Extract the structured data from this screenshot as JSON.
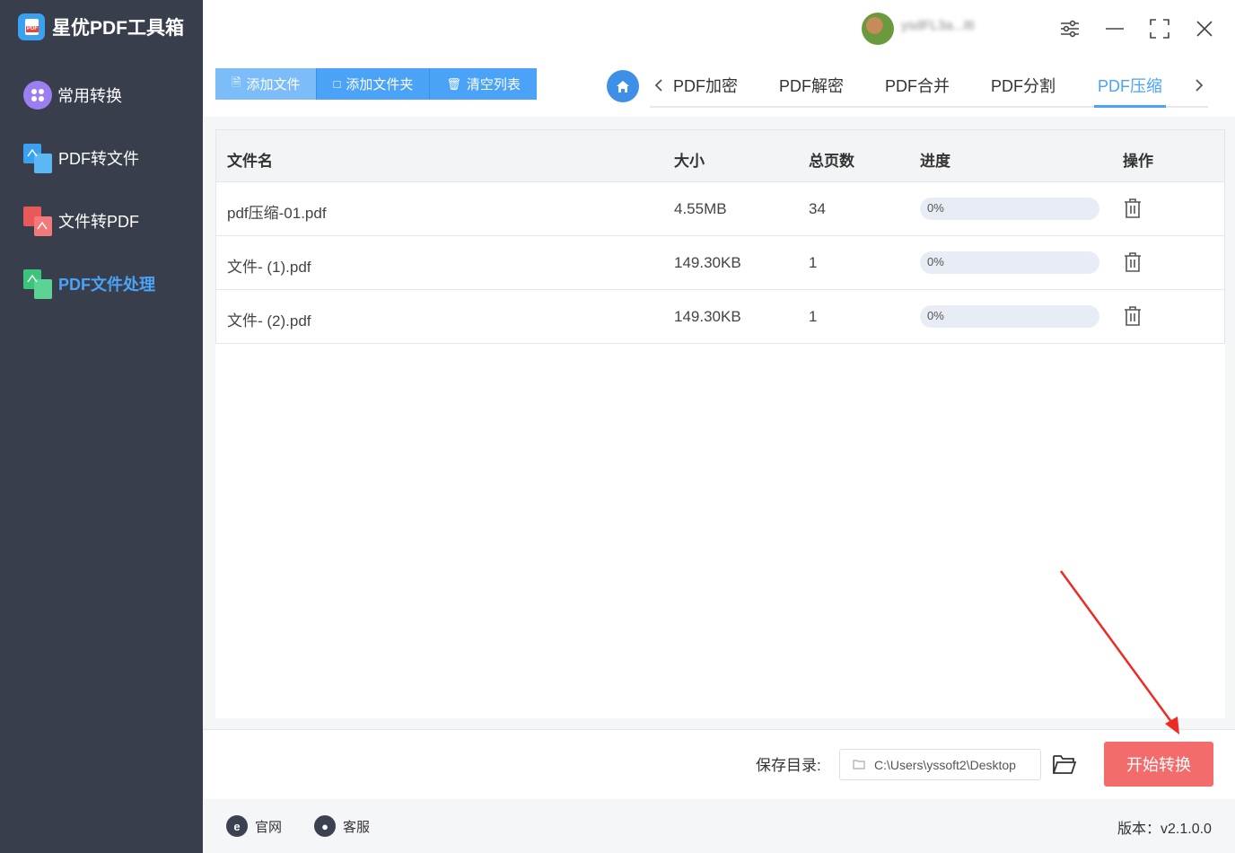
{
  "app": {
    "title": "星优PDF工具箱"
  },
  "sidebar": {
    "items": [
      {
        "label": "常用转换",
        "icon": "apps-icon",
        "active": false
      },
      {
        "label": "PDF转文件",
        "icon": "pdf-to-file-icon",
        "active": false
      },
      {
        "label": "文件转PDF",
        "icon": "file-to-pdf-icon",
        "active": false
      },
      {
        "label": "PDF文件处理",
        "icon": "pdf-process-icon",
        "active": true
      }
    ]
  },
  "header": {
    "username": "ysdFL3a...l6",
    "controls": [
      "settings-icon",
      "minimize-icon",
      "maximize-icon",
      "close-icon"
    ]
  },
  "toolbar": {
    "add_file": "添加文件",
    "add_folder": "添加文件夹",
    "clear_list": "清空列表"
  },
  "tabs": {
    "items": [
      "PDF加密",
      "PDF解密",
      "PDF合并",
      "PDF分割",
      "PDF压缩"
    ],
    "active": "PDF压缩"
  },
  "table": {
    "columns": [
      "文件名",
      "大小",
      "总页数",
      "进度",
      "操作"
    ],
    "rows": [
      {
        "name": "pdf压缩-01.pdf",
        "size": "4.55MB",
        "pages": "34",
        "progress": "0%"
      },
      {
        "name": "文件- (1).pdf",
        "size": "149.30KB",
        "pages": "1",
        "progress": "0%"
      },
      {
        "name": "文件- (2).pdf",
        "size": "149.30KB",
        "pages": "1",
        "progress": "0%"
      }
    ]
  },
  "save": {
    "label": "保存目录:",
    "path": "C:\\Users\\yssoft2\\Desktop"
  },
  "start_button": "开始转换",
  "footer": {
    "website": "官网",
    "support": "客服",
    "version": "版本：v2.1.0.0"
  },
  "colors": {
    "sidebar_bg": "#393e4c",
    "accent": "#4aa3f7",
    "start_button": "#f46b6b"
  }
}
